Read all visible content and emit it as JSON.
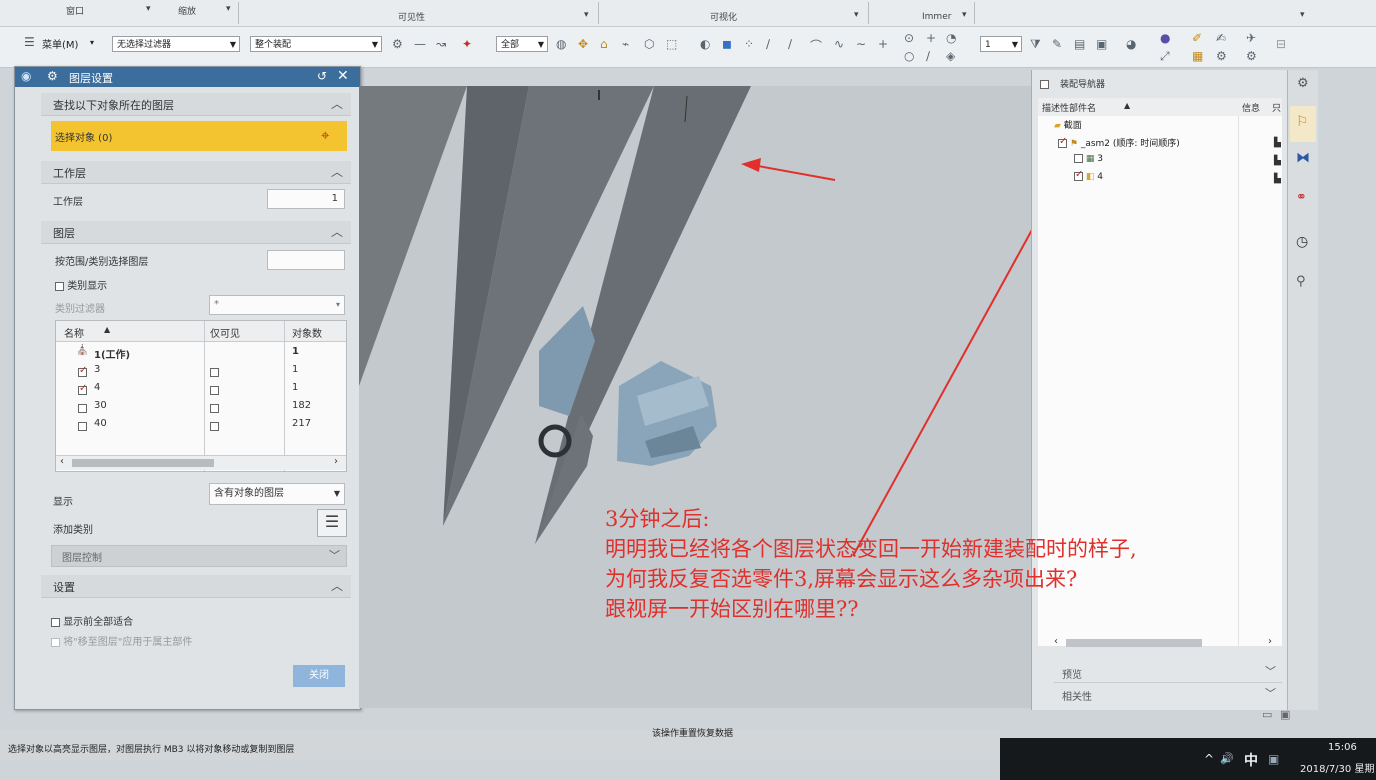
{
  "ribbon": {
    "groups": [
      "窗口",
      "缩放",
      "可见性",
      "可视化",
      "Immer"
    ]
  },
  "toolbar": {
    "menu_label": "菜单(M)",
    "filter_value": "无选择过滤器",
    "scope_value": "整个装配",
    "all_value": "全部",
    "num_value": "1"
  },
  "dialog": {
    "title": "图层设置",
    "find_section": {
      "heading": "查找以下对象所在的图层",
      "select_label": "选择对象 (0)"
    },
    "work_section": {
      "heading": "工作层",
      "label": "工作层",
      "value": "1"
    },
    "layer_section": {
      "heading": "图层",
      "range_label": "按范围/类别选择图层",
      "category_display": "类别显示",
      "category_filter_label": "类别过滤器",
      "category_filter_value": "*",
      "columns": [
        "名称",
        "仅可见",
        "对象数"
      ],
      "rows": [
        {
          "name": "1(工作)",
          "count": "1"
        },
        {
          "name": "3",
          "count": "1",
          "checked": true
        },
        {
          "name": "4",
          "count": "1",
          "checked": true
        },
        {
          "name": "30",
          "count": "182",
          "checked": false
        },
        {
          "name": "40",
          "count": "217",
          "checked": false
        }
      ],
      "display_label": "显示",
      "display_value": "含有对象的图层",
      "add_category_label": "添加类别",
      "layer_control_label": "图层控制"
    },
    "settings_section": {
      "heading": "设置",
      "fit_all_label": "显示前全部适合",
      "apply_owner_label": "将\"移至图层\"应用于属主部件"
    },
    "close_label": "关闭"
  },
  "navigator": {
    "title": "装配导航器",
    "col_name": "描述性部件名",
    "col_info": "信息",
    "col_extra": "只",
    "items": [
      "截面",
      "_asm2 (顺序: 时间顺序)",
      "3",
      "4"
    ],
    "preview_label": "预览",
    "dependency_label": "相关性"
  },
  "status": {
    "left_text": "选择对象以高亮显示图层，对图层执行 MB3 以将对象移动或复制到图层",
    "center_text": "该操作重置恢复数据"
  },
  "taskbar": {
    "ime": "中",
    "time": "15:06",
    "date": "2018/7/30 星期"
  },
  "annotation": {
    "lines": [
      "3分钟之后:",
      "  明明我已经将各个图层状态变回一开始新建装配时的样子,",
      "为何我反复否选零件3,屏幕会显示这么多杂项出来?",
      "跟视屏一开始区别在哪里??"
    ],
    "color": "#e0302c"
  }
}
